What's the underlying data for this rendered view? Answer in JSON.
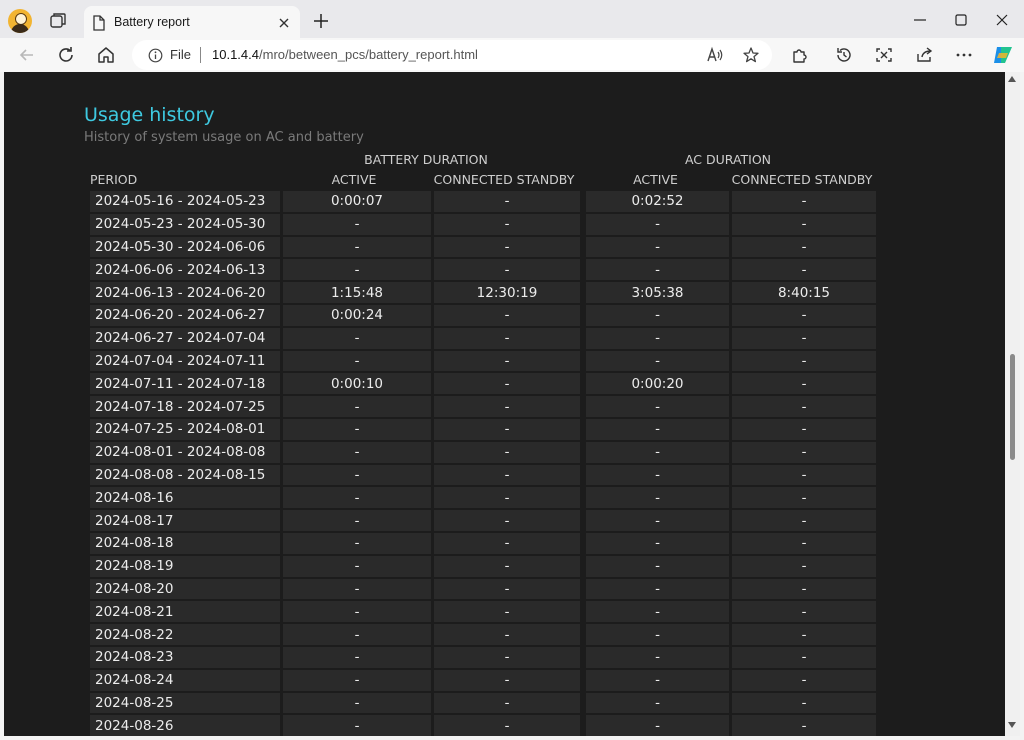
{
  "browser": {
    "tab_title": "Battery report",
    "file_label": "File",
    "url_host": "10.1.4.4",
    "url_path": "/mro/between_pcs/battery_report.html"
  },
  "page": {
    "heading": "Usage history",
    "subheading": "History of system usage on AC and battery",
    "battery_group": "BATTERY DURATION",
    "ac_group": "AC DURATION",
    "columns": [
      "PERIOD",
      "ACTIVE",
      "CONNECTED STANDBY",
      "ACTIVE",
      "CONNECTED STANDBY"
    ],
    "rows": [
      [
        "2024-05-16 - 2024-05-23",
        "0:00:07",
        "-",
        "0:02:52",
        "-"
      ],
      [
        "2024-05-23 - 2024-05-30",
        "-",
        "-",
        "-",
        "-"
      ],
      [
        "2024-05-30 - 2024-06-06",
        "-",
        "-",
        "-",
        "-"
      ],
      [
        "2024-06-06 - 2024-06-13",
        "-",
        "-",
        "-",
        "-"
      ],
      [
        "2024-06-13 - 2024-06-20",
        "1:15:48",
        "12:30:19",
        "3:05:38",
        "8:40:15"
      ],
      [
        "2024-06-20 - 2024-06-27",
        "0:00:24",
        "-",
        "-",
        "-"
      ],
      [
        "2024-06-27 - 2024-07-04",
        "-",
        "-",
        "-",
        "-"
      ],
      [
        "2024-07-04 - 2024-07-11",
        "-",
        "-",
        "-",
        "-"
      ],
      [
        "2024-07-11 - 2024-07-18",
        "0:00:10",
        "-",
        "0:00:20",
        "-"
      ],
      [
        "2024-07-18 - 2024-07-25",
        "-",
        "-",
        "-",
        "-"
      ],
      [
        "2024-07-25 - 2024-08-01",
        "-",
        "-",
        "-",
        "-"
      ],
      [
        "2024-08-01 - 2024-08-08",
        "-",
        "-",
        "-",
        "-"
      ],
      [
        "2024-08-08 - 2024-08-15",
        "-",
        "-",
        "-",
        "-"
      ],
      [
        "2024-08-16",
        "-",
        "-",
        "-",
        "-"
      ],
      [
        "2024-08-17",
        "-",
        "-",
        "-",
        "-"
      ],
      [
        "2024-08-18",
        "-",
        "-",
        "-",
        "-"
      ],
      [
        "2024-08-19",
        "-",
        "-",
        "-",
        "-"
      ],
      [
        "2024-08-20",
        "-",
        "-",
        "-",
        "-"
      ],
      [
        "2024-08-21",
        "-",
        "-",
        "-",
        "-"
      ],
      [
        "2024-08-22",
        "-",
        "-",
        "-",
        "-"
      ],
      [
        "2024-08-23",
        "-",
        "-",
        "-",
        "-"
      ],
      [
        "2024-08-24",
        "-",
        "-",
        "-",
        "-"
      ],
      [
        "2024-08-25",
        "-",
        "-",
        "-",
        "-"
      ],
      [
        "2024-08-26",
        "-",
        "-",
        "-",
        "-"
      ]
    ]
  },
  "colors": {
    "heading": "#3ec9e0",
    "content_bg": "#1c1c1c",
    "cell_bg": "#2a2a2a"
  },
  "icons": {
    "profile": "avatar-icon",
    "workspaces": "workspaces-icon",
    "tab_page": "page-icon",
    "tab_close": "close-icon",
    "new_tab": "plus-icon",
    "minimize": "minimize-icon",
    "maximize": "maximize-icon",
    "close_window": "close-icon",
    "back": "arrow-left-icon",
    "refresh": "refresh-icon",
    "home": "home-icon",
    "site_info": "info-icon",
    "read_aloud": "read-aloud-icon",
    "favorite": "star-icon",
    "extensions": "puzzle-icon",
    "history": "history-icon",
    "screenshot": "screenshot-icon",
    "share": "share-icon",
    "more": "more-icon",
    "copilot": "copilot-icon"
  }
}
